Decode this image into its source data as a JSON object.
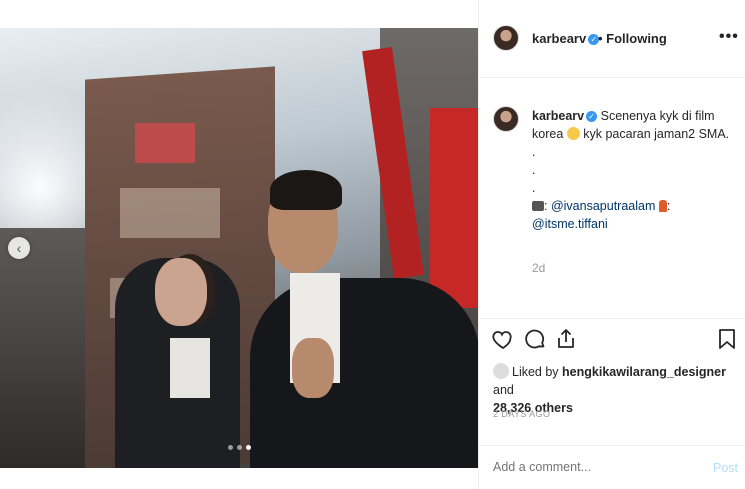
{
  "header": {
    "username": "karbearv",
    "following_label": "• Following",
    "more_label": "•••"
  },
  "caption": {
    "username": "karbearv",
    "text_before_emoji": "Scenenya kyk di film korea",
    "text_after_emoji": "kyk pacaran jaman2 SMA.",
    "dots": [
      ".",
      ".",
      "."
    ],
    "credit_prefix": ":",
    "mention_photographer": "@ivansaputraalam",
    "credit_mid": ":",
    "mention_makeup": "@itsme.tiffani",
    "time_ago": "2d"
  },
  "likes": {
    "liked_by_prefix": "Liked by",
    "liked_by_user": "hengkikawilarang_designer",
    "and_label": "and",
    "others_count": "28,326 others"
  },
  "post_age": "2 DAYS AGO",
  "comment": {
    "placeholder": "Add a comment...",
    "post_label": "Post"
  },
  "carousel": {
    "prev_icon": "‹",
    "slide_count": 3,
    "active_index": 2
  },
  "colors": {
    "verified": "#3897f0",
    "post_button_disabled": "#b2dffc",
    "mention": "#003569"
  }
}
